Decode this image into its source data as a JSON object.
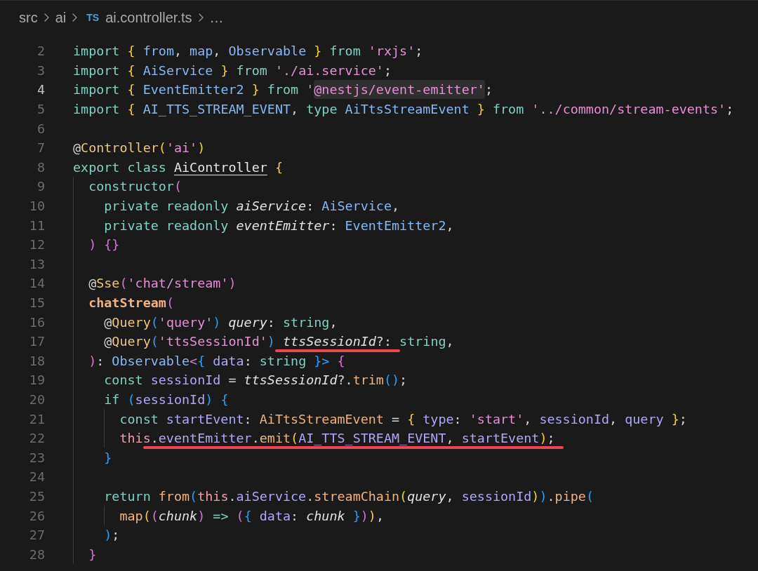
{
  "breadcrumb": {
    "items": [
      {
        "kind": "folder",
        "label": "src"
      },
      {
        "kind": "folder",
        "label": "ai"
      },
      {
        "kind": "file",
        "badge": "TS",
        "label": "ai.controller.ts"
      },
      {
        "kind": "more",
        "label": "…"
      }
    ]
  },
  "editor": {
    "lines": [
      {
        "number": "2",
        "active": false,
        "segments": [
          {
            "kind": "plain",
            "tokens": [
              {
                "kind": "keyword",
                "text": "import"
              },
              {
                "kind": "bracket1",
                "text": " {"
              },
              {
                "kind": "name",
                "text": " from"
              },
              {
                "kind": "punct",
                "text": ","
              },
              {
                "kind": "name",
                "text": " map"
              },
              {
                "kind": "punct",
                "text": ","
              },
              {
                "kind": "name",
                "text": " Observable"
              },
              {
                "kind": "bracket1",
                "text": " }"
              },
              {
                "kind": "keyword",
                "text": " from"
              },
              {
                "kind": "string",
                "text": " 'rxjs'"
              },
              {
                "kind": "punct",
                "text": ";"
              }
            ]
          }
        ]
      },
      {
        "number": "3",
        "active": false,
        "segments": [
          {
            "kind": "plain",
            "tokens": [
              {
                "kind": "keyword",
                "text": "import"
              },
              {
                "kind": "bracket1",
                "text": " {"
              },
              {
                "kind": "name",
                "text": " AiService"
              },
              {
                "kind": "bracket1",
                "text": " }"
              },
              {
                "kind": "keyword",
                "text": " from"
              },
              {
                "kind": "string",
                "text": " './ai.service'"
              },
              {
                "kind": "punct",
                "text": ";"
              }
            ]
          }
        ]
      },
      {
        "number": "4",
        "active": true,
        "segments": [
          {
            "kind": "plain",
            "tokens": [
              {
                "kind": "keyword",
                "text": "import"
              },
              {
                "kind": "bracket1",
                "text": " {"
              },
              {
                "kind": "name",
                "text": " EventEmitter2"
              },
              {
                "kind": "bracket1",
                "text": " }"
              },
              {
                "kind": "keyword",
                "text": " from"
              },
              {
                "kind": "string",
                "text": " '"
              }
            ]
          },
          {
            "kind": "highlight",
            "tokens": [
              {
                "kind": "string",
                "text": "@nestjs/event-emitter'"
              }
            ]
          },
          {
            "kind": "plain",
            "tokens": [
              {
                "kind": "punct",
                "text": ";"
              }
            ]
          }
        ]
      },
      {
        "number": "5",
        "active": false,
        "segments": [
          {
            "kind": "plain",
            "tokens": [
              {
                "kind": "keyword",
                "text": "import"
              },
              {
                "kind": "bracket1",
                "text": " {"
              },
              {
                "kind": "name",
                "text": " AI_TTS_STREAM_EVENT"
              },
              {
                "kind": "punct",
                "text": ","
              },
              {
                "kind": "keyword",
                "text": " type"
              },
              {
                "kind": "name",
                "text": " AiTtsStreamEvent"
              },
              {
                "kind": "bracket1",
                "text": " }"
              },
              {
                "kind": "keyword",
                "text": " from"
              },
              {
                "kind": "string",
                "text": " '../common/stream-events'"
              },
              {
                "kind": "punct",
                "text": ";"
              }
            ]
          }
        ]
      },
      {
        "number": "6",
        "active": false
      },
      {
        "number": "7",
        "active": false,
        "segments": [
          {
            "kind": "plain",
            "tokens": [
              {
                "kind": "punct",
                "text": "@"
              },
              {
                "kind": "decorator",
                "text": "Controller"
              },
              {
                "kind": "bracket1",
                "text": "("
              },
              {
                "kind": "string",
                "text": "'ai'"
              },
              {
                "kind": "bracket1",
                "text": ")"
              }
            ]
          }
        ]
      },
      {
        "number": "8",
        "active": false,
        "segments": [
          {
            "kind": "plain",
            "tokens": [
              {
                "kind": "keyword",
                "text": "export class "
              },
              {
                "kind": "classname",
                "text": "AiController"
              },
              {
                "kind": "bracket1",
                "text": " {"
              }
            ]
          }
        ]
      },
      {
        "number": "9",
        "active": false,
        "segments": [
          {
            "kind": "plain",
            "tokens": [
              {
                "kind": "keyword",
                "text": "  constructor"
              },
              {
                "kind": "bracket2",
                "text": "("
              }
            ]
          }
        ]
      },
      {
        "number": "10",
        "active": false,
        "segments": [
          {
            "kind": "plain",
            "tokens": [
              {
                "kind": "keyword",
                "text": "    private readonly "
              },
              {
                "kind": "parameter",
                "text": "aiService"
              },
              {
                "kind": "punct",
                "text": ":"
              },
              {
                "kind": "name",
                "text": " AiService"
              },
              {
                "kind": "punct",
                "text": ","
              }
            ]
          }
        ]
      },
      {
        "number": "11",
        "active": false,
        "segments": [
          {
            "kind": "plain",
            "tokens": [
              {
                "kind": "keyword",
                "text": "    private readonly "
              },
              {
                "kind": "parameter",
                "text": "eventEmitter"
              },
              {
                "kind": "punct",
                "text": ":"
              },
              {
                "kind": "name",
                "text": " EventEmitter2"
              },
              {
                "kind": "punct",
                "text": ","
              }
            ]
          }
        ]
      },
      {
        "number": "12",
        "active": false,
        "segments": [
          {
            "kind": "plain",
            "tokens": [
              {
                "kind": "bracket2",
                "text": "  ) {}"
              }
            ]
          }
        ]
      },
      {
        "number": "13",
        "active": false
      },
      {
        "number": "14",
        "active": false,
        "segments": [
          {
            "kind": "plain",
            "tokens": [
              {
                "kind": "punct",
                "text": "  @"
              },
              {
                "kind": "decorator",
                "text": "Sse"
              },
              {
                "kind": "bracket2",
                "text": "("
              },
              {
                "kind": "string",
                "text": "'chat/stream'"
              },
              {
                "kind": "bracket2",
                "text": ")"
              }
            ]
          }
        ]
      },
      {
        "number": "15",
        "active": false,
        "segments": [
          {
            "kind": "plain",
            "tokens": [
              {
                "kind": "definition",
                "text": "  chatStream"
              },
              {
                "kind": "bracket2",
                "text": "("
              }
            ]
          }
        ]
      },
      {
        "number": "16",
        "active": false,
        "segments": [
          {
            "kind": "plain",
            "tokens": [
              {
                "kind": "punct",
                "text": "    @"
              },
              {
                "kind": "decorator",
                "text": "Query"
              },
              {
                "kind": "bracket3",
                "text": "("
              },
              {
                "kind": "string",
                "text": "'query'"
              },
              {
                "kind": "bracket3",
                "text": ")"
              },
              {
                "kind": "parameter",
                "text": " query"
              },
              {
                "kind": "punct",
                "text": ":"
              },
              {
                "kind": "keyword",
                "text": " string"
              },
              {
                "kind": "punct",
                "text": ","
              }
            ]
          }
        ]
      },
      {
        "number": "17",
        "active": false,
        "segments": [
          {
            "kind": "plain",
            "tokens": [
              {
                "kind": "punct",
                "text": "    @"
              },
              {
                "kind": "decorator",
                "text": "Query"
              },
              {
                "kind": "bracket3",
                "text": "("
              },
              {
                "kind": "string",
                "text": "'ttsSessionId'"
              },
              {
                "kind": "bracket3",
                "text": ") "
              }
            ]
          },
          {
            "kind": "underline",
            "tokens": [
              {
                "kind": "parameter",
                "text": "ttsSessionId"
              },
              {
                "kind": "punct",
                "text": "?:"
              }
            ]
          },
          {
            "kind": "plain",
            "tokens": [
              {
                "kind": "keyword",
                "text": " string"
              },
              {
                "kind": "punct",
                "text": ","
              }
            ]
          }
        ]
      },
      {
        "number": "18",
        "active": false,
        "segments": [
          {
            "kind": "plain",
            "tokens": [
              {
                "kind": "bracket2",
                "text": "  )"
              },
              {
                "kind": "punct",
                "text": ":"
              },
              {
                "kind": "name",
                "text": " Observable"
              },
              {
                "kind": "bracket2",
                "text": "<"
              },
              {
                "kind": "bracket3",
                "text": "{"
              },
              {
                "kind": "property",
                "text": " data"
              },
              {
                "kind": "punct",
                "text": ":"
              },
              {
                "kind": "keyword",
                "text": " string"
              },
              {
                "kind": "bracket3",
                "text": " }>"
              },
              {
                "kind": "bracket2",
                "text": " {"
              }
            ]
          }
        ]
      },
      {
        "number": "19",
        "active": false,
        "segments": [
          {
            "kind": "plain",
            "tokens": [
              {
                "kind": "keyword",
                "text": "    const"
              },
              {
                "kind": "property",
                "text": " sessionId"
              },
              {
                "kind": "punct",
                "text": " ="
              },
              {
                "kind": "parameter",
                "text": " ttsSessionId"
              },
              {
                "kind": "punct",
                "text": "?."
              },
              {
                "kind": "call",
                "text": "trim"
              },
              {
                "kind": "bracket3",
                "text": "()"
              },
              {
                "kind": "punct",
                "text": ";"
              }
            ]
          }
        ]
      },
      {
        "number": "20",
        "active": false,
        "segments": [
          {
            "kind": "plain",
            "tokens": [
              {
                "kind": "keyword",
                "text": "    if"
              },
              {
                "kind": "bracket3",
                "text": " ("
              },
              {
                "kind": "property",
                "text": "sessionId"
              },
              {
                "kind": "bracket3",
                "text": ") {"
              }
            ]
          }
        ]
      },
      {
        "number": "21",
        "active": false,
        "segments": [
          {
            "kind": "plain",
            "tokens": [
              {
                "kind": "keyword",
                "text": "      const"
              },
              {
                "kind": "property",
                "text": " startEvent"
              },
              {
                "kind": "punct",
                "text": ":"
              },
              {
                "kind": "typeref",
                "text": " AiTtsStreamEvent"
              },
              {
                "kind": "punct",
                "text": " ="
              },
              {
                "kind": "bracket1",
                "text": " {"
              },
              {
                "kind": "property",
                "text": " type"
              },
              {
                "kind": "punct",
                "text": ":"
              },
              {
                "kind": "string",
                "text": " 'start'"
              },
              {
                "kind": "punct",
                "text": ","
              },
              {
                "kind": "property",
                "text": " sessionId"
              },
              {
                "kind": "punct",
                "text": ","
              },
              {
                "kind": "property",
                "text": " query"
              },
              {
                "kind": "bracket1",
                "text": " }"
              },
              {
                "kind": "punct",
                "text": ";"
              }
            ]
          }
        ]
      },
      {
        "number": "22",
        "active": false,
        "segments": [
          {
            "kind": "plain",
            "tokens": [
              {
                "kind": "self",
                "text": "      this"
              }
            ]
          },
          {
            "kind": "underline",
            "tokens": [
              {
                "kind": "punct",
                "text": "."
              },
              {
                "kind": "property",
                "text": "eventEmitter"
              },
              {
                "kind": "punct",
                "text": "."
              },
              {
                "kind": "call",
                "text": "emit"
              },
              {
                "kind": "bracket1",
                "text": "("
              },
              {
                "kind": "property",
                "text": "AI_TTS_STREAM_EVENT"
              },
              {
                "kind": "punct",
                "text": ","
              },
              {
                "kind": "property",
                "text": " startEvent"
              },
              {
                "kind": "bracket1",
                "text": ")"
              },
              {
                "kind": "punct",
                "text": ";"
              }
            ]
          }
        ]
      },
      {
        "number": "23",
        "active": false,
        "segments": [
          {
            "kind": "plain",
            "tokens": [
              {
                "kind": "bracket3",
                "text": "    }"
              }
            ]
          }
        ]
      },
      {
        "number": "24",
        "active": false
      },
      {
        "number": "25",
        "active": false,
        "segments": [
          {
            "kind": "plain",
            "tokens": [
              {
                "kind": "keyword",
                "text": "    return"
              },
              {
                "kind": "call",
                "text": " from"
              },
              {
                "kind": "bracket3",
                "text": "("
              },
              {
                "kind": "self",
                "text": "this"
              },
              {
                "kind": "punct",
                "text": "."
              },
              {
                "kind": "property",
                "text": "aiService"
              },
              {
                "kind": "punct",
                "text": "."
              },
              {
                "kind": "call",
                "text": "streamChain"
              },
              {
                "kind": "bracket1",
                "text": "("
              },
              {
                "kind": "parameter",
                "text": "query"
              },
              {
                "kind": "punct",
                "text": ","
              },
              {
                "kind": "property",
                "text": " sessionId"
              },
              {
                "kind": "bracket1",
                "text": ")"
              },
              {
                "kind": "bracket3",
                "text": ")"
              },
              {
                "kind": "punct",
                "text": "."
              },
              {
                "kind": "call",
                "text": "pipe"
              },
              {
                "kind": "bracket3",
                "text": "("
              }
            ]
          }
        ]
      },
      {
        "number": "26",
        "active": false,
        "segments": [
          {
            "kind": "plain",
            "tokens": [
              {
                "kind": "call",
                "text": "      map"
              },
              {
                "kind": "bracket1",
                "text": "("
              },
              {
                "kind": "bracket2",
                "text": "("
              },
              {
                "kind": "parameter",
                "text": "chunk"
              },
              {
                "kind": "bracket2",
                "text": ")"
              },
              {
                "kind": "keyword",
                "text": " =>"
              },
              {
                "kind": "bracket2",
                "text": " ("
              },
              {
                "kind": "bracket3",
                "text": "{"
              },
              {
                "kind": "property",
                "text": " data"
              },
              {
                "kind": "punct",
                "text": ":"
              },
              {
                "kind": "parameter",
                "text": " chunk"
              },
              {
                "kind": "bracket3",
                "text": " }"
              },
              {
                "kind": "bracket2",
                "text": ")"
              },
              {
                "kind": "bracket1",
                "text": ")"
              },
              {
                "kind": "punct",
                "text": ","
              }
            ]
          }
        ]
      },
      {
        "number": "27",
        "active": false,
        "segments": [
          {
            "kind": "plain",
            "tokens": [
              {
                "kind": "bracket3",
                "text": "    )"
              },
              {
                "kind": "punct",
                "text": ";"
              }
            ]
          }
        ]
      },
      {
        "number": "28",
        "active": false,
        "segments": [
          {
            "kind": "plain",
            "tokens": [
              {
                "kind": "bracket2",
                "text": "  }"
              }
            ]
          }
        ]
      }
    ]
  }
}
